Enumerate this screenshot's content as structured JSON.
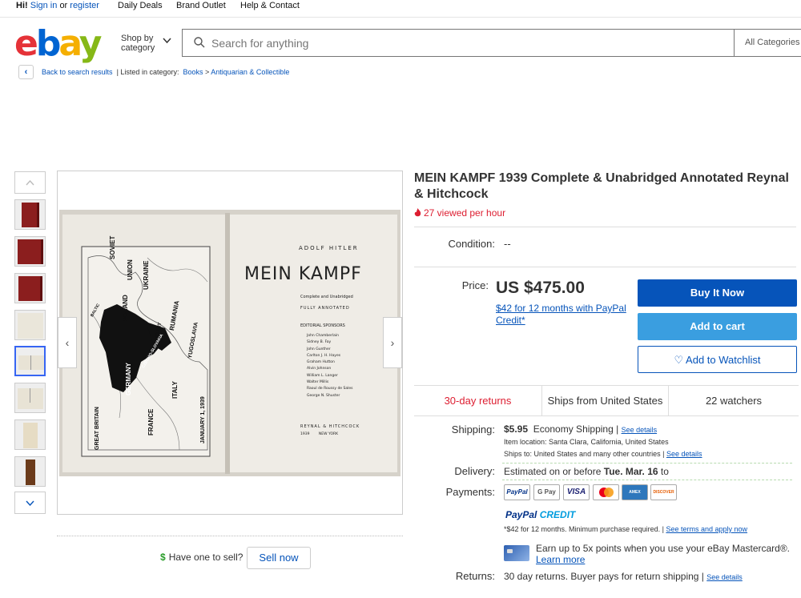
{
  "topbar": {
    "greeting": "Hi!",
    "sign_in": "Sign in",
    "or": "or",
    "register": "register",
    "links": [
      "Daily Deals",
      "Brand Outlet",
      "Help & Contact"
    ]
  },
  "header": {
    "logo": [
      "e",
      "b",
      "a",
      "y"
    ],
    "shop_by": "Shop by category",
    "search_placeholder": "Search for anything",
    "category_select": "All Categories"
  },
  "breadcrumb": {
    "back": "Back to search results",
    "separator": "|",
    "listed_in": "Listed in category:",
    "path": [
      "Books",
      "Antiquarian & Collectible"
    ],
    "arrow": ">"
  },
  "gallery": {
    "selected_index": 4,
    "thumb_kinds": [
      "red",
      "red",
      "red",
      "page",
      "open-sel",
      "open",
      "page",
      "brown"
    ],
    "prev": "‹",
    "next": "›",
    "photo_text": {
      "author": "ADOLF HITLER",
      "title": "MEIN KAMPF",
      "sub1": "Complete and Unabridged",
      "sub2": "FULLY ANNOTATED",
      "sponsors_head": "EDITORIAL SPONSORS",
      "sponsors": [
        "John Chamberlain",
        "Sidney B. Fay",
        "John Gunther",
        "Carlton J. H. Hayes",
        "Graham Hutton",
        "Alvin Johnson",
        "William L. Langer",
        "Walter Millis",
        "Raoul de Roussy de Sales",
        "George N. Shuster"
      ],
      "publisher": "REYNAL & HITCHCOCK",
      "pub_place": "1939        NEW YORK",
      "map_labels": [
        "SOVIET",
        "UNION",
        "UKRAINE",
        "POLAND",
        "RUMANIA",
        "HUNGARY",
        "YUGOSLAVIA",
        "GERMANY",
        "FRANCE",
        "ITALY",
        "GREAT BRITAIN",
        "JANUARY 1, 1939",
        "BALTIC",
        "CZECHO-SLOVAKIA"
      ]
    }
  },
  "sell": {
    "question": "Have one to sell?",
    "button": "Sell now"
  },
  "item": {
    "title": "MEIN KAMPF 1939 Complete & Unabridged Annotated Reynal & Hitchcock",
    "viewed": "27 viewed per hour",
    "condition_label": "Condition:",
    "condition_value": "--",
    "price_label": "Price:",
    "price": "US $475.00",
    "credit_offer": "$42 for 12 months with PayPal Credit*",
    "buy_now": "Buy It Now",
    "add_to_cart": "Add to cart",
    "watchlist": "Add to Watchlist",
    "watch_heart": "♡"
  },
  "stats": {
    "returns": "30-day returns",
    "ships_from": "Ships from United States",
    "watchers": "22 watchers"
  },
  "shipping": {
    "label": "Shipping:",
    "cost": "$5.95",
    "method": "Economy Shipping |",
    "details": "See details",
    "location": "Item location:  Santa Clara, California, United States",
    "ships_to": "Ships to:  United States and many other countries |",
    "ships_to_details": "See details"
  },
  "delivery": {
    "label": "Delivery:",
    "prefix": "Estimated on or before",
    "date": "Tue. Mar. 16",
    "suffix": "to"
  },
  "payments": {
    "label": "Payments:",
    "methods": [
      "PayPal",
      "G Pay",
      "VISA",
      "MC",
      "AMEX",
      "DISCOVER"
    ],
    "paypal_credit_a": "PayPal",
    "paypal_credit_b": "CREDIT",
    "credit_note": "*$42 for 12 months. Minimum purchase required. |",
    "credit_terms": "See terms and apply now",
    "mastercard_line": "Earn up to 5x points when you use your eBay Mastercard®.",
    "learn_more": "Learn more"
  },
  "returns": {
    "label": "Returns:",
    "text": "30 day returns. Buyer pays for return shipping |",
    "details": "See details"
  },
  "colors": {
    "link": "#0654ba",
    "buy": "#0654ba",
    "cart": "#3a9ee0",
    "alert": "#dd1e31"
  }
}
